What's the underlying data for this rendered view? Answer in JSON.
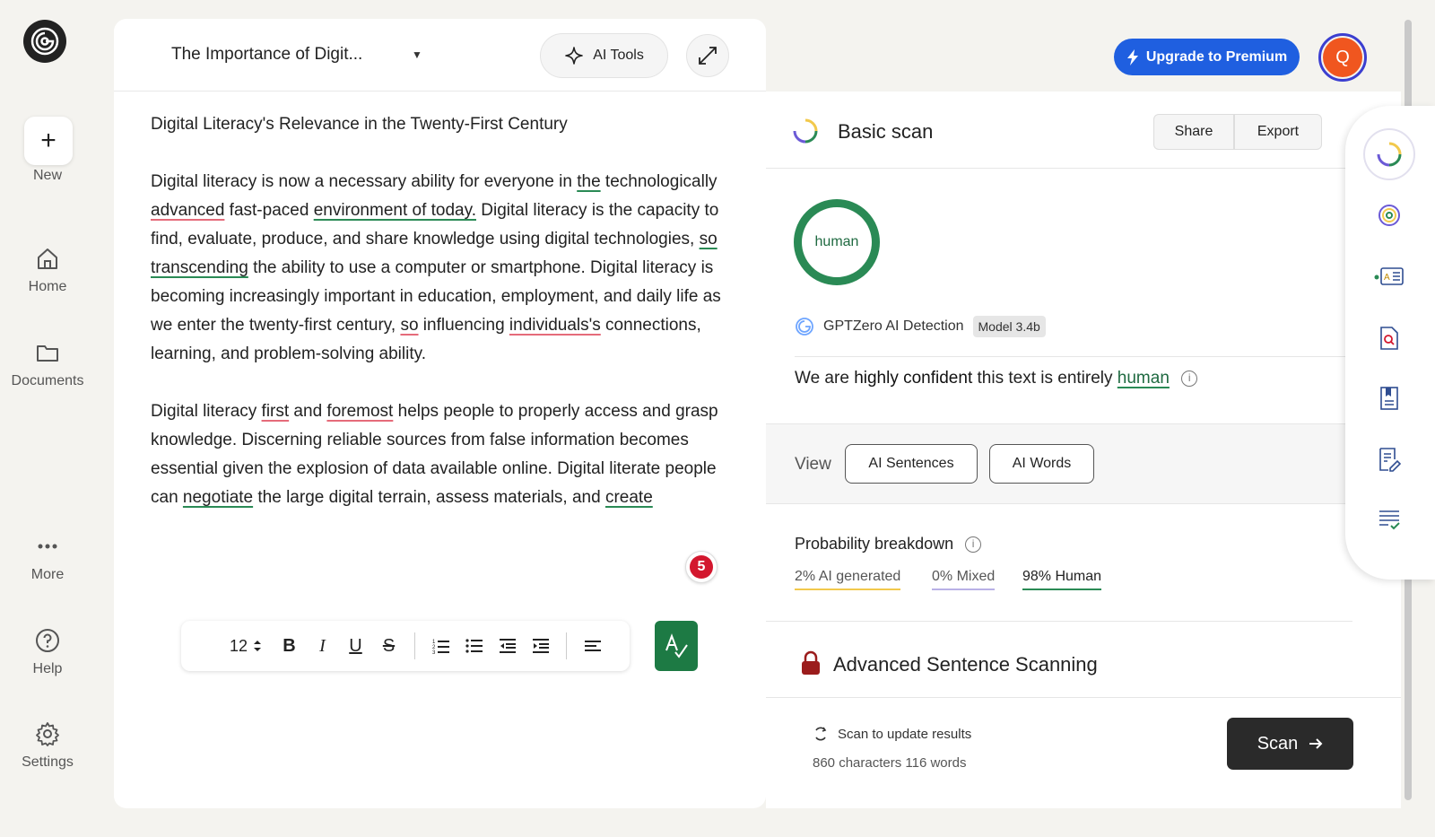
{
  "nav": {
    "new_label": "New",
    "home_label": "Home",
    "documents_label": "Documents",
    "more_label": "More",
    "help_label": "Help",
    "settings_label": "Settings"
  },
  "editor": {
    "doc_title": "The Importance of Digit...",
    "ai_tools_label": "AI Tools",
    "heading": "Digital Literacy's Relevance in the Twenty-First Century",
    "p1": [
      {
        "t": "Digital literacy is now a necessary ability for everyone in ",
        "u": ""
      },
      {
        "t": "the",
        "u": "g"
      },
      {
        "t": " technologically ",
        "u": ""
      },
      {
        "t": "advanced",
        "u": "r"
      },
      {
        "t": " fast-paced ",
        "u": ""
      },
      {
        "t": "environment of today.",
        "u": "g"
      },
      {
        "t": " Digital literacy is the capacity to find, evaluate, produce, and share knowledge using digital technologies, ",
        "u": ""
      },
      {
        "t": "so transcending",
        "u": "g"
      },
      {
        "t": " the ability to use a computer or smartphone. Digital literacy is becoming increasingly important in education, employment, and daily life as we enter the twenty-first century, ",
        "u": ""
      },
      {
        "t": "so",
        "u": "r"
      },
      {
        "t": " influencing ",
        "u": ""
      },
      {
        "t": "individuals's",
        "u": "r"
      },
      {
        "t": " connections, learning, and problem-solving ability.",
        "u": ""
      }
    ],
    "p2": [
      {
        "t": "Digital literacy ",
        "u": ""
      },
      {
        "t": "first",
        "u": "r"
      },
      {
        "t": " and ",
        "u": ""
      },
      {
        "t": "foremost",
        "u": "r"
      },
      {
        "t": " helps people to properly access and grasp knowledge. Discerning reliable sources from false information becomes essential given the explosion of data available online. Digital literate people can ",
        "u": ""
      },
      {
        "t": "negotiate",
        "u": "g"
      },
      {
        "t": " the large digital terrain, assess materials, and ",
        "u": ""
      },
      {
        "t": "create",
        "u": "g"
      }
    ],
    "issue_count": "5",
    "font_size": "12"
  },
  "header": {
    "upgrade_label": "Upgrade to Premium",
    "avatar_initial": "Q"
  },
  "scan": {
    "title": "Basic scan",
    "share_label": "Share",
    "export_label": "Export",
    "result_label": "human",
    "detector_name": "GPTZero AI Detection",
    "model_badge": "Model 3.4b",
    "confidence_prefix": "We are ",
    "confidence_strong": "highly confident",
    "confidence_mid": " this text is entirely ",
    "confidence_result": "human",
    "view_label": "View",
    "view_sentences": "AI Sentences",
    "view_words": "AI Words",
    "prob_title": "Probability breakdown",
    "prob_ai": "2% AI generated",
    "prob_mixed": "0% Mixed",
    "prob_human": "98% Human",
    "advanced_title": "Advanced Sentence Scanning",
    "update_hint": "Scan to update results",
    "counts": "860 characters 116 words",
    "scan_button": "Scan"
  },
  "colors": {
    "accent_green": "#2a8a55",
    "brand_blue": "#1f5fe0",
    "issue_red": "#d3172e",
    "ai_yellow": "#f2c94c",
    "mixed_purple": "#b9b1e6"
  }
}
